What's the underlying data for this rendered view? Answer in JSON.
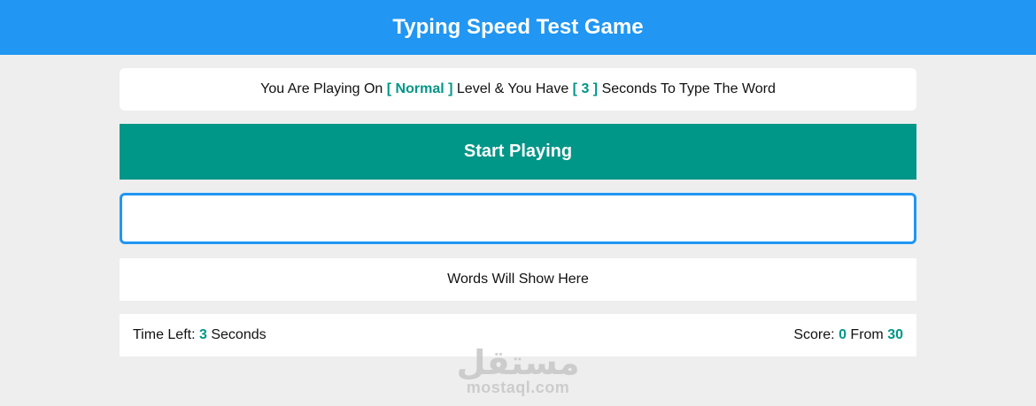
{
  "header": {
    "title": "Typing Speed Test Game"
  },
  "message": {
    "prefix": "You Are Playing On",
    "level": "[ Normal ]",
    "middle": "Level & You Have",
    "seconds": "[ 3 ]",
    "suffix": "Seconds To Type The Word"
  },
  "start_button": {
    "label": "Start Playing"
  },
  "input": {
    "value": "",
    "placeholder": ""
  },
  "words": {
    "text": "Words Will Show Here"
  },
  "control": {
    "time_label": "Time Left:",
    "time_value": "3",
    "time_unit": "Seconds",
    "score_label": "Score:",
    "score_value": "0",
    "score_from": "From",
    "score_total": "30"
  },
  "watermark": {
    "arabic": "مستقل",
    "latin": "mostaql.com"
  },
  "colors": {
    "header": "#2196f3",
    "accent": "#009688",
    "background": "#eeeeee"
  }
}
